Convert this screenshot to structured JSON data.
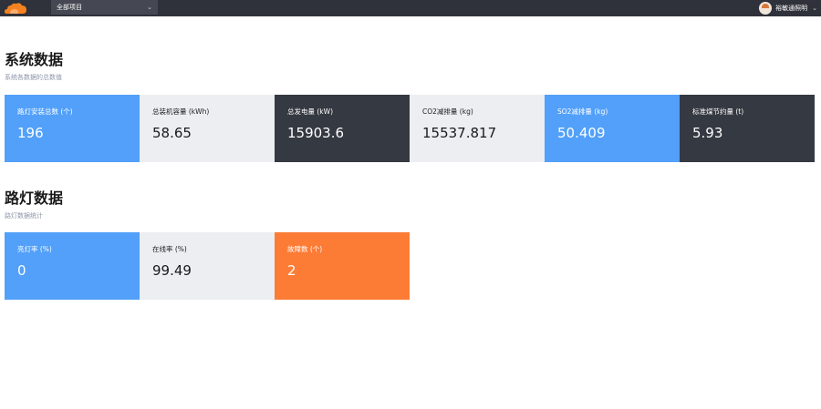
{
  "header": {
    "project_select": "全部项目",
    "user_name": "裕敏通照明"
  },
  "system": {
    "title": "系统数据",
    "subtitle": "系统各数据的总数值",
    "cards": [
      {
        "label": "路灯安装总数 (个)",
        "value": "196"
      },
      {
        "label": "总装机容量 (kWh)",
        "value": "58.65"
      },
      {
        "label": "总发电量 (kW)",
        "value": "15903.6"
      },
      {
        "label": "CO2减排量 (kg)",
        "value": "15537.817"
      },
      {
        "label": "SO2减排量 (kg)",
        "value": "50.409"
      },
      {
        "label": "标准煤节约量 (t)",
        "value": "5.93"
      }
    ]
  },
  "streetlight": {
    "title": "路灯数据",
    "subtitle": "路灯数据统计",
    "cards": [
      {
        "label": "亮灯率 (%)",
        "value": "0"
      },
      {
        "label": "在线率 (%)",
        "value": "99.49"
      },
      {
        "label": "故障数 (个)",
        "value": "2"
      }
    ]
  },
  "colors": {
    "topbar": "#2f323a",
    "blue": "#52a0f9",
    "gray": "#eceef2",
    "dark": "#353941",
    "orange": "#fd7c35",
    "logo": "#f58220"
  }
}
